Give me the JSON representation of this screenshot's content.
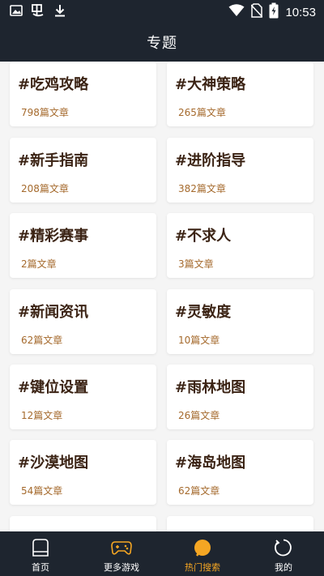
{
  "status_bar": {
    "time": "10:53"
  },
  "header": {
    "title": "专题"
  },
  "topics": [
    {
      "title": "#吃鸡攻略",
      "count": "798篇文章"
    },
    {
      "title": "#大神策略",
      "count": "265篇文章"
    },
    {
      "title": "#新手指南",
      "count": "208篇文章"
    },
    {
      "title": "#进阶指导",
      "count": "382篇文章"
    },
    {
      "title": "#精彩赛事",
      "count": "2篇文章"
    },
    {
      "title": "#不求人",
      "count": "3篇文章"
    },
    {
      "title": "#新闻资讯",
      "count": "62篇文章"
    },
    {
      "title": "#灵敏度",
      "count": "10篇文章"
    },
    {
      "title": "#键位设置",
      "count": "12篇文章"
    },
    {
      "title": "#雨林地图",
      "count": "26篇文章"
    },
    {
      "title": "#沙漠地图",
      "count": "54篇文章"
    },
    {
      "title": "#海岛地图",
      "count": "62篇文章"
    }
  ],
  "tabs": [
    {
      "label": "首页",
      "icon": "home-icon"
    },
    {
      "label": "更多游戏",
      "icon": "gamepad-icon"
    },
    {
      "label": "热门搜索",
      "icon": "hot-search-icon"
    },
    {
      "label": "我的",
      "icon": "profile-icon"
    }
  ],
  "colors": {
    "bar_background": "#1e252f",
    "card_title": "#3b2314",
    "card_count": "#a56a2d",
    "active_tab": "#f5a623"
  }
}
